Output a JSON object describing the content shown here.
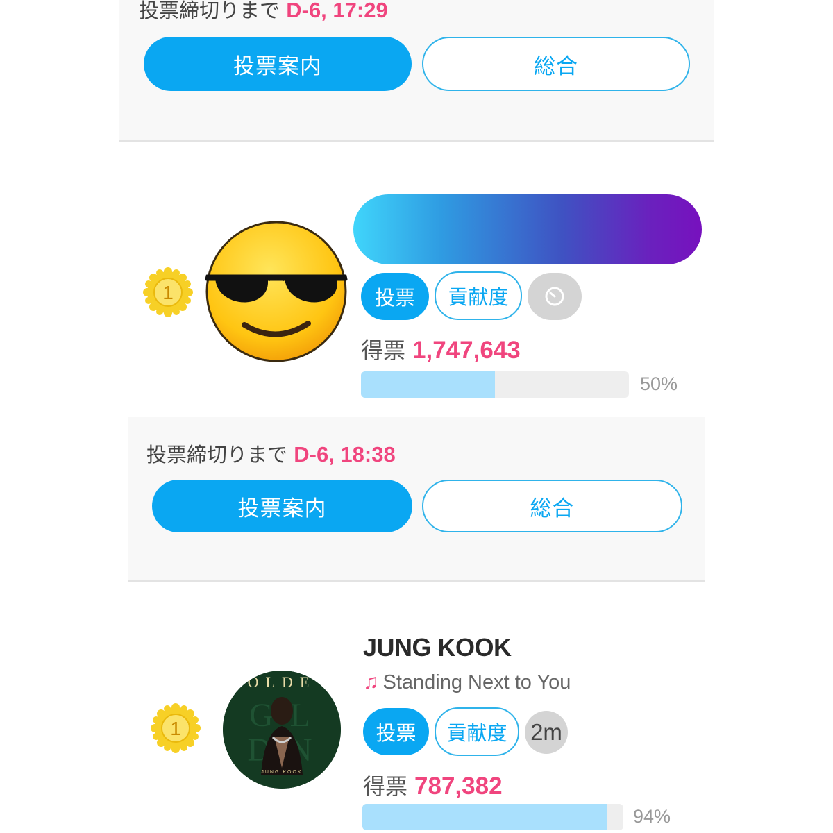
{
  "sections": [
    {
      "deadline": {
        "label": "投票締切りまで",
        "value": "D-6, 17:29"
      },
      "buttons": {
        "guide": "投票案内",
        "overall": "総合"
      }
    },
    {
      "deadline": {
        "label": "投票締切りまで",
        "value": "D-6, 18:38"
      },
      "buttons": {
        "guide": "投票案内",
        "overall": "総合"
      }
    }
  ],
  "entries": [
    {
      "rank": "1",
      "avatar_icon": "sunglasses-emoji-icon",
      "actions": {
        "vote": "投票",
        "contribution": "貢献度",
        "timer_icon": "timer-icon"
      },
      "votes_label": "得票",
      "votes": "1,747,643",
      "progress_percent": 50,
      "progress_label": "50%"
    },
    {
      "rank": "1",
      "artist": "JUNG KOOK",
      "song": "Standing Next to You",
      "note_icon": "music-note-icon",
      "cover_text": {
        "top": "OLDE",
        "bottom": "JUNG KOOK"
      },
      "actions": {
        "vote": "投票",
        "contribution": "貢献度",
        "timer": "2m"
      },
      "votes_label": "得票",
      "votes": "787,382",
      "progress_percent": 94,
      "progress_label": "94%"
    }
  ],
  "colors": {
    "accent_blue": "#0aa7f2",
    "accent_pink": "#f0457e",
    "progress_fill": "#a9e0fd",
    "medal_gold": "#f7cf20"
  }
}
